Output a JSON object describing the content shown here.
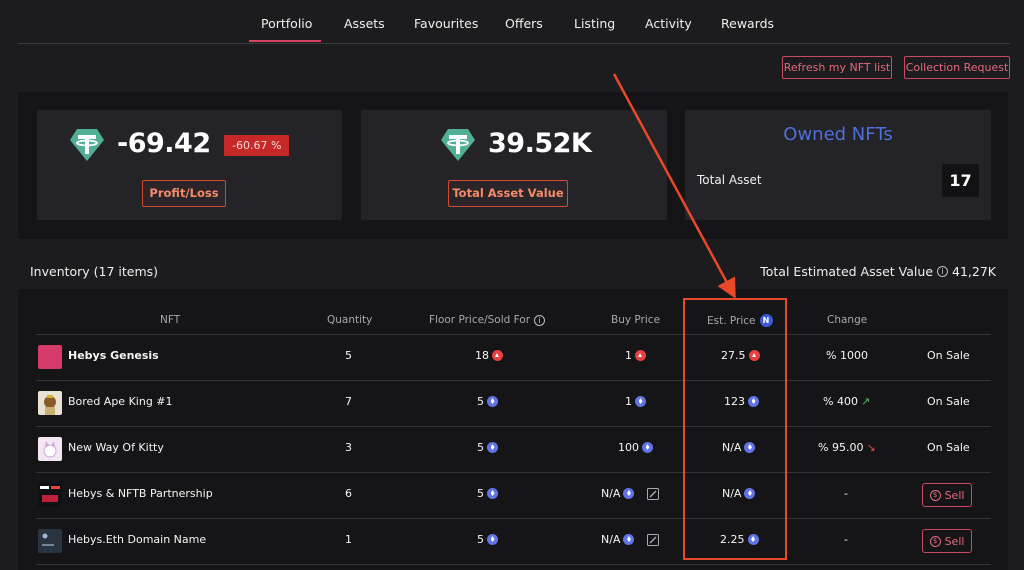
{
  "nav": {
    "tabs": [
      {
        "label": "Portfolio",
        "active": true
      },
      {
        "label": "Assets"
      },
      {
        "label": "Favourites"
      },
      {
        "label": "Offers"
      },
      {
        "label": "Listing"
      },
      {
        "label": "Activity"
      },
      {
        "label": "Rewards"
      }
    ]
  },
  "actions": {
    "refresh": "Refresh my NFT list",
    "collection_request": "Collection Request"
  },
  "summary": {
    "profit_value": "-69.42",
    "profit_pct": "-60.67 %",
    "profit_button": "Profit/Loss",
    "asset_value": "39.52K",
    "asset_button": "Total Asset Value",
    "owned_title": "Owned NFTs",
    "total_asset_label": "Total Asset",
    "total_asset_count": "17"
  },
  "inventory": {
    "label": "Inventory (17 items)",
    "est_total_label": "Total Estimated Asset Value",
    "est_total_value": "41,27K"
  },
  "table": {
    "headers": {
      "nft": "NFT",
      "quantity": "Quantity",
      "floor": "Floor Price/Sold For",
      "buy": "Buy Price",
      "est": "Est. Price",
      "change": "Change"
    },
    "rows": [
      {
        "name": "Hebys Genesis",
        "quantity": "5",
        "floor": "18",
        "floor_coin": "avax",
        "buy": "1",
        "buy_coin": "avax",
        "est": "27.5",
        "est_coin": "avax",
        "change": "% 1000",
        "change_dir": "",
        "status": "On Sale"
      },
      {
        "name": "Bored Ape King #1",
        "quantity": "7",
        "floor": "5",
        "floor_coin": "eth",
        "buy": "1",
        "buy_coin": "eth",
        "est": "123",
        "est_coin": "eth",
        "change": "% 400",
        "change_dir": "up",
        "status": "On Sale"
      },
      {
        "name": "New Way Of Kitty",
        "quantity": "3",
        "floor": "5",
        "floor_coin": "eth",
        "buy": "100",
        "buy_coin": "eth",
        "est": "N/A",
        "est_coin": "eth",
        "change": "% 95.00",
        "change_dir": "down",
        "status": "On Sale"
      },
      {
        "name": "Hebys & NFTB Partnership",
        "quantity": "6",
        "floor": "5",
        "floor_coin": "eth",
        "buy": "N/A",
        "buy_coin": "eth",
        "est": "N/A",
        "est_coin": "eth",
        "change": "-",
        "change_dir": "",
        "status": "Sell"
      },
      {
        "name": "Hebys.Eth Domain Name",
        "quantity": "1",
        "floor": "5",
        "floor_coin": "eth",
        "buy": "N/A",
        "buy_coin": "eth",
        "est": "2.25",
        "est_coin": "eth",
        "change": "-",
        "change_dir": "",
        "status": "Sell"
      }
    ]
  },
  "colors": {
    "accent": "#d6455f",
    "annotation": "#e8492a",
    "owned_title": "#4f6fd9",
    "tether": "#50af95"
  }
}
